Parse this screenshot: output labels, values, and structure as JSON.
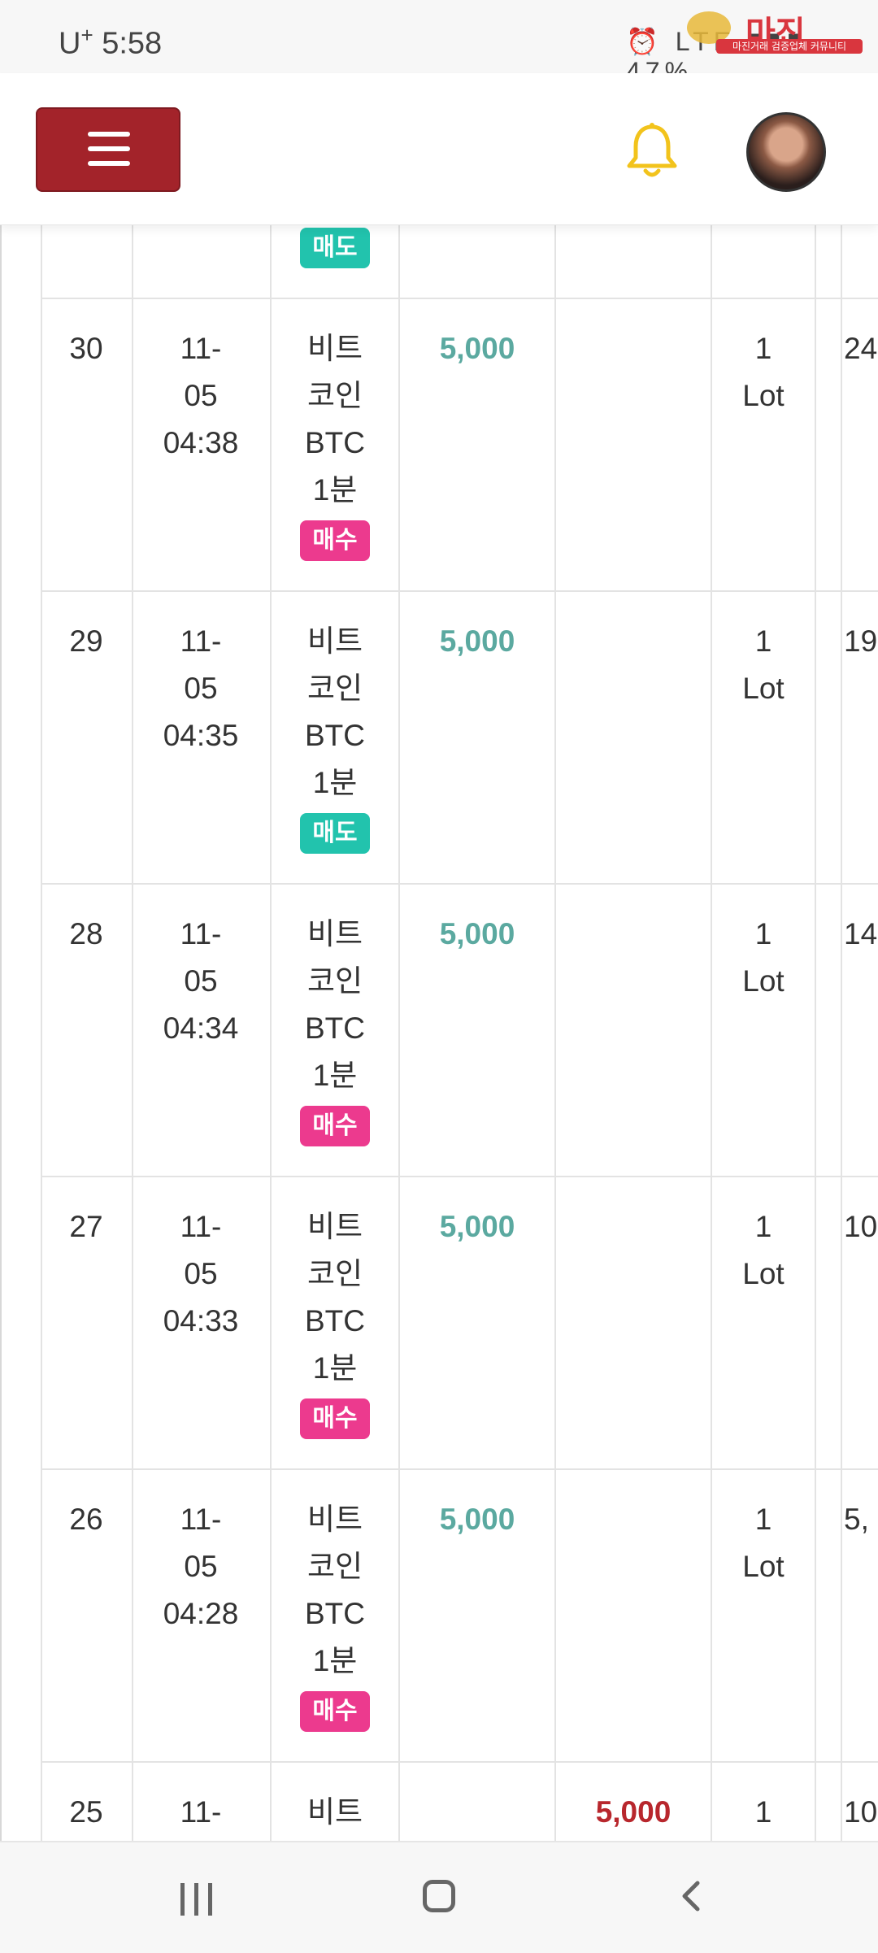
{
  "status_bar": {
    "carrier": "U",
    "carrier_plus": "+",
    "time": "5:58",
    "icons": "⏰ LTE ▮▮▮ 47%"
  },
  "watermark": {
    "title": "마진",
    "subtitle": "마진거래 검증업체 커뮤니티"
  },
  "header": {
    "menu_icon": "hamburger-icon",
    "bell_icon": "bell-icon",
    "accent_color": "#a3232a",
    "bell_color": "#f2c31c"
  },
  "table": {
    "top_partial": {
      "badge": "매도"
    },
    "rows": [
      {
        "no": "30",
        "date": "11-",
        "date2": "05",
        "time": "04:38",
        "product_1": "비트",
        "product_2": "코인",
        "product_3": "BTC",
        "product_4": "1분",
        "side": "매수",
        "buy_amount": "5,000",
        "sell_amount": "",
        "qty": "1",
        "unit": "Lot",
        "extra": "24"
      },
      {
        "no": "29",
        "date": "11-",
        "date2": "05",
        "time": "04:35",
        "product_1": "비트",
        "product_2": "코인",
        "product_3": "BTC",
        "product_4": "1분",
        "side": "매도",
        "buy_amount": "5,000",
        "sell_amount": "",
        "qty": "1",
        "unit": "Lot",
        "extra": "19"
      },
      {
        "no": "28",
        "date": "11-",
        "date2": "05",
        "time": "04:34",
        "product_1": "비트",
        "product_2": "코인",
        "product_3": "BTC",
        "product_4": "1분",
        "side": "매수",
        "buy_amount": "5,000",
        "sell_amount": "",
        "qty": "1",
        "unit": "Lot",
        "extra": "14"
      },
      {
        "no": "27",
        "date": "11-",
        "date2": "05",
        "time": "04:33",
        "product_1": "비트",
        "product_2": "코인",
        "product_3": "BTC",
        "product_4": "1분",
        "side": "매수",
        "buy_amount": "5,000",
        "sell_amount": "",
        "qty": "1",
        "unit": "Lot",
        "extra": "10"
      },
      {
        "no": "26",
        "date": "11-",
        "date2": "05",
        "time": "04:28",
        "product_1": "비트",
        "product_2": "코인",
        "product_3": "BTC",
        "product_4": "1분",
        "side": "매수",
        "buy_amount": "5,000",
        "sell_amount": "",
        "qty": "1",
        "unit": "Lot",
        "extra": "5,"
      },
      {
        "no": "25",
        "date": "11-",
        "product_1": "비트",
        "buy_amount": "",
        "sell_amount": "5,000",
        "qty": "1",
        "extra": "10"
      }
    ]
  },
  "nav": {
    "recent_icon": "recent-apps-icon",
    "home_icon": "home-icon",
    "back_icon": "back-icon"
  }
}
